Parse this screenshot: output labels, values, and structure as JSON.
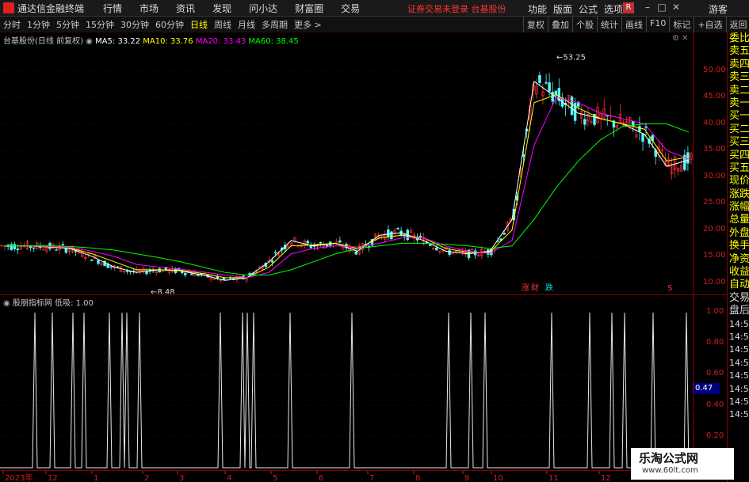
{
  "titlebar": {
    "app_title": "通达信金融终端",
    "menu": [
      "行情",
      "市场",
      "资讯",
      "发现",
      "问小达",
      "财富圈",
      "交易"
    ],
    "notice": "证券交易未登录  台基股份",
    "right_menu": [
      "功能",
      "版面",
      "公式",
      "选项"
    ],
    "r_badge": "R",
    "win_min": "–",
    "win_max": "□",
    "win_close": "✕",
    "guest": "游客"
  },
  "toolbar": {
    "periods": [
      "分时",
      "1分钟",
      "5分钟",
      "15分钟",
      "30分钟",
      "60分钟",
      "日线",
      "周线",
      "月线",
      "多周期",
      "更多 >"
    ],
    "active_period": "日线",
    "tools": [
      "复权",
      "叠加",
      "个股",
      "统计",
      "画线",
      "F10",
      "标记",
      "+自选",
      "返回"
    ]
  },
  "main_legend": {
    "stock": "台基股份(日线 前复权)",
    "ma5": "MA5: 33.22",
    "ma10": "MA10: 33.76",
    "ma20": "MA20: 33.43",
    "ma60": "MA60: 38.45"
  },
  "sub_legend": {
    "indicator": "股朋指标网",
    "value": "低吸: 1.00"
  },
  "annotations": {
    "high": "53.25",
    "low": "8.48",
    "tag1": "涨",
    "tag2": "财",
    "tag3": "跌",
    "tag4": "S"
  },
  "price_axis": [
    "50.00",
    "45.00",
    "40.00",
    "35.00",
    "30.00",
    "25.00",
    "20.00",
    "15.00",
    "10.00"
  ],
  "sub_axis": [
    "1.00",
    "0.80",
    "0.60",
    "0.40",
    "0.20"
  ],
  "sub_current": "0.47",
  "date_axis": [
    "2023年",
    "12",
    "1",
    "2",
    "3",
    "4",
    "5",
    "6",
    "7",
    "8",
    "9",
    "10",
    "11",
    "12"
  ],
  "sidepanel": [
    "委比",
    "卖五",
    "卖四",
    "卖三",
    "卖二",
    "卖一",
    "买一",
    "买二",
    "买三",
    "买四",
    "买五",
    "现价",
    "涨跌",
    "涨幅",
    "总量",
    "外盘",
    "换手",
    "净资",
    "收益",
    "自动",
    "交易",
    "盘后",
    "14:56",
    "14:56",
    "14:56",
    "14:56",
    "14:56",
    "14:56",
    "14:56",
    "14:56"
  ],
  "watermark": {
    "line1": "乐淘公式网",
    "line2": "www.60lt.com"
  },
  "colors": {
    "up": "#ff3232",
    "down": "#54fcfc",
    "ma5": "#ffffff",
    "ma10": "#ffff00",
    "ma20": "#ff00ff",
    "ma60": "#00ff00",
    "grid": "#8b0000"
  },
  "chart_data": {
    "type": "line",
    "title": "",
    "ylim": [
      8,
      55
    ],
    "series": [
      {
        "name": "MA5",
        "values": [
          17,
          17,
          16.8,
          16.5,
          15,
          13,
          12,
          12.5,
          12.3,
          11.5,
          10.5,
          11,
          14,
          18,
          17,
          17.5,
          16,
          19,
          19.5,
          18,
          16,
          15.5,
          16,
          22,
          48,
          45,
          42,
          41,
          40,
          38,
          32,
          33.2
        ]
      },
      {
        "name": "MA10",
        "values": [
          17,
          17,
          16.8,
          16.6,
          15.5,
          14,
          12.5,
          12.5,
          12.4,
          11.8,
          11,
          11,
          13,
          17,
          17.2,
          17.5,
          16.5,
          18.5,
          19,
          18.5,
          16.5,
          15.8,
          15.8,
          20,
          44,
          45.5,
          43,
          41,
          40,
          39,
          33,
          33.8
        ]
      },
      {
        "name": "MA20",
        "values": [
          17,
          17,
          16.9,
          16.7,
          16,
          15,
          13.5,
          13,
          12.6,
          12.1,
          11.5,
          11,
          12,
          15.5,
          16.5,
          17,
          16.8,
          17.5,
          18.5,
          18.5,
          17,
          16,
          15.6,
          18,
          36,
          45,
          44,
          42,
          41,
          40,
          35,
          33.4
        ]
      },
      {
        "name": "MA60",
        "values": [
          17,
          17,
          17,
          16.9,
          16.6,
          16.2,
          15.5,
          14.8,
          14,
          13,
          12,
          11.5,
          11.5,
          12.5,
          14,
          15.5,
          16.5,
          17,
          17.5,
          17.5,
          17.3,
          17,
          16.5,
          17,
          22,
          28,
          33,
          37,
          39.5,
          40,
          40,
          38.45
        ]
      }
    ],
    "indicator_series": {
      "name": "低吸",
      "spike_positions": [
        44,
        66,
        92,
        106,
        138,
        154,
        160,
        176,
        278,
        306,
        312,
        320,
        366,
        444,
        566,
        594,
        612,
        696,
        744,
        772,
        788,
        824,
        866
      ],
      "ylim": [
        0,
        1.0
      ]
    }
  }
}
